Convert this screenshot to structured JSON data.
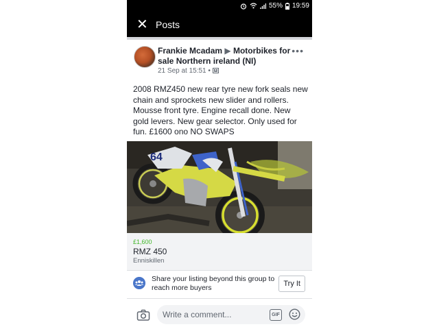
{
  "status_bar": {
    "battery": "55%",
    "time": "19:59"
  },
  "header": {
    "title": "Posts",
    "close_icon": "close-icon"
  },
  "post": {
    "author": "Frankie Mcadam",
    "group": "Motorbikes for sale Northern ireland (NI)",
    "date": "21 Sep at 15:51",
    "separator": "•",
    "body": "2008 RMZ450 new rear tyre  new fork seals new chain and sprockets new slider and rollers. Mousse front tyre. Engine recall done. New gold levers. New gear selector. Only used for fun.   £1600 ono   NO SWAPS",
    "photo_bike_number": "64"
  },
  "listing": {
    "price": "£1,600",
    "title": "RMZ 450",
    "location": "Enniskillen"
  },
  "share": {
    "text": "Share your listing beyond this group to reach more buyers",
    "button": "Try It"
  },
  "comment": {
    "placeholder": "Write a comment...",
    "gif_label": "GIF"
  },
  "colors": {
    "price_green": "#42b72a",
    "header_black": "#000000",
    "link_blue": "#4a76c9"
  }
}
